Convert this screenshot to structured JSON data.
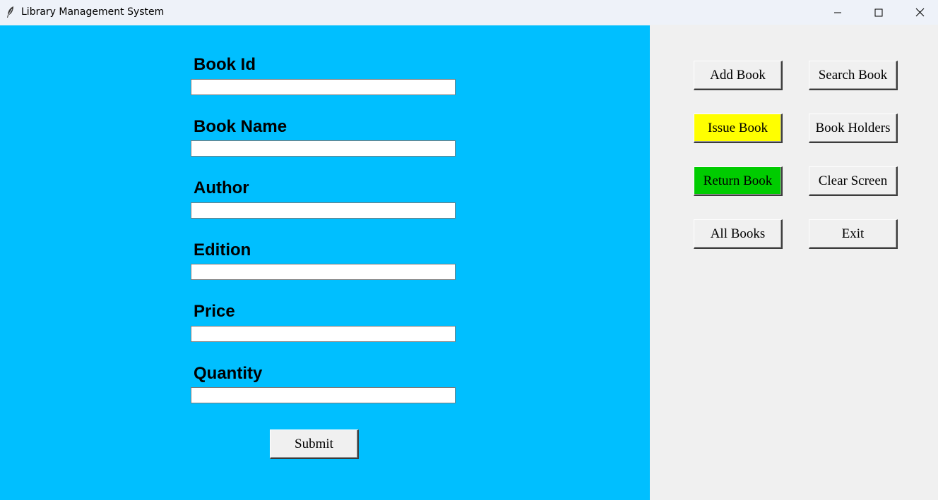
{
  "window": {
    "title": "Library Management System"
  },
  "form": {
    "fields": [
      {
        "label": "Book Id",
        "value": ""
      },
      {
        "label": "Book Name",
        "value": ""
      },
      {
        "label": "Author",
        "value": ""
      },
      {
        "label": "Edition",
        "value": ""
      },
      {
        "label": "Price",
        "value": ""
      },
      {
        "label": "Quantity",
        "value": ""
      }
    ],
    "submit_label": "Submit"
  },
  "menu": {
    "add_book": "Add Book",
    "search_book": "Search Book",
    "issue_book": "Issue Book",
    "book_holders": "Book Holders",
    "return_book": "Return Book",
    "clear_screen": "Clear Screen",
    "all_books": "All Books",
    "exit": "Exit"
  },
  "colors": {
    "form_background": "#00bfff",
    "issue_book_button": "#ffff00",
    "return_book_button": "#00cc00",
    "panel_background": "#f0f0f0"
  }
}
